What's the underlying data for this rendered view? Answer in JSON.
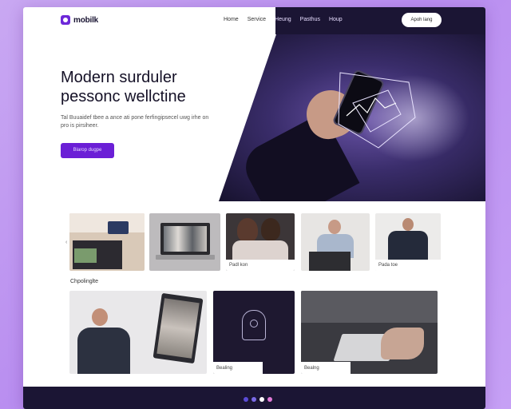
{
  "brand": {
    "name": "mobilk"
  },
  "nav": {
    "links": [
      "Home",
      "Service",
      "Heung",
      "Pasthus",
      "Houp"
    ],
    "cta": "Apoh lang"
  },
  "hero": {
    "title": "Modern surduler pessonc wellctine",
    "subtitle": "Tal Buuaidef tbee a ance ati pone ferfingipsecel uwg irhe on pro is pirsiheer.",
    "button": "Blarop dugpe"
  },
  "carousel": {
    "items": [
      {
        "caption": ""
      },
      {
        "caption": ""
      },
      {
        "caption": "Padl kon"
      },
      {
        "caption": ""
      },
      {
        "caption": "Pada toe"
      }
    ],
    "prev_icon": "chevron-left-icon",
    "next_icon": "chevron-right-icon"
  },
  "section": {
    "label": "Chpolinglte"
  },
  "features": [
    {
      "caption": ""
    },
    {
      "caption": "Bealing"
    },
    {
      "caption": "Bealng"
    }
  ],
  "pager": {
    "dots": [
      {
        "color": "#5a4bd6"
      },
      {
        "color": "#7a6ae6"
      },
      {
        "color": "#ffffff"
      },
      {
        "color": "#e27bd8"
      }
    ]
  },
  "colors": {
    "accent": "#6b1fd6",
    "dark": "#1b1534",
    "background": "#c9a8f2"
  }
}
